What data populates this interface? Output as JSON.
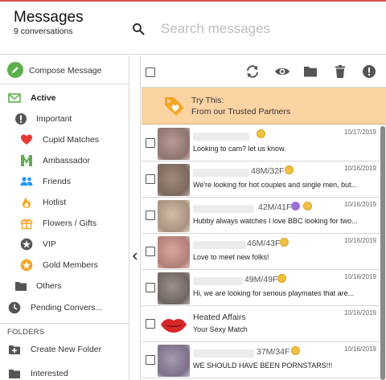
{
  "header": {
    "title": "Messages",
    "count": "9 conversations",
    "search_placeholder": "Search messages"
  },
  "sidebar": {
    "compose_label": "Compose Message",
    "items": [
      {
        "label": "Active",
        "icon": "envelope-icon",
        "color": "#5bb04c"
      },
      {
        "label": "Important",
        "icon": "exclamation-circle-icon",
        "color": "#555555"
      },
      {
        "label": "Cupid Matches",
        "icon": "heart-icon",
        "color": "#e53935"
      },
      {
        "label": "Ambassador",
        "icon": "ambassador-icon",
        "color": "#5bb04c"
      },
      {
        "label": "Friends",
        "icon": "friends-icon",
        "color": "#2196f3"
      },
      {
        "label": "Hotlist",
        "icon": "flame-icon",
        "color": "#f5a623"
      },
      {
        "label": "Flowers / Gifts",
        "icon": "gift-icon",
        "color": "#f5a623"
      },
      {
        "label": "VIP",
        "icon": "star-circle-icon",
        "color": "#555555"
      },
      {
        "label": "Gold Members",
        "icon": "gold-star-icon",
        "color": "#f5a623"
      },
      {
        "label": "Others",
        "icon": "folder-icon",
        "color": "#555555"
      },
      {
        "label": "Pending Convers...",
        "icon": "clock-icon",
        "color": "#555555"
      }
    ],
    "folders_title": "FOLDERS",
    "folder_items": [
      {
        "label": "Create New Folder",
        "icon": "folder-plus-icon"
      },
      {
        "label": "Interested",
        "icon": "folder-icon"
      }
    ]
  },
  "promo": {
    "line1": "Try This:",
    "line2": "From our Trusted Partners"
  },
  "messages": [
    {
      "meta": "",
      "date": "10/17/2019",
      "preview": "Looking to cam? let us know.",
      "badges": [
        "gold"
      ]
    },
    {
      "meta": "48M/32F",
      "date": "10/16/2019",
      "preview": "We're looking for hot couples and single men, but...",
      "badges": [
        "gold"
      ]
    },
    {
      "meta": "42M/41F",
      "date": "10/16/2019",
      "preview": "Hubby always watches I love BBC looking for two...",
      "badges": [
        "purple",
        "gold"
      ]
    },
    {
      "meta": "46M/43F",
      "date": "10/16/2019",
      "preview": "Love to meet new folks!",
      "badges": [
        "gold"
      ]
    },
    {
      "meta": "49M/49F",
      "date": "10/16/2019",
      "preview": "Hi, we are looking for serious playmates that are...",
      "badges": [
        "gold"
      ]
    },
    {
      "sender": "Heated Affairs",
      "date": "10/16/2019",
      "preview": "Your Sexy Match",
      "badges": []
    },
    {
      "meta": "37M/34F",
      "date": "10/16/2019",
      "preview": "WE SHOULD HAVE BEEN PORNSTARS!!!",
      "badges": [
        "gold"
      ]
    }
  ],
  "colors": {
    "promo_bg": "#fcd3a3",
    "accent_green": "#5bb04c",
    "gold": "#f0c040"
  }
}
